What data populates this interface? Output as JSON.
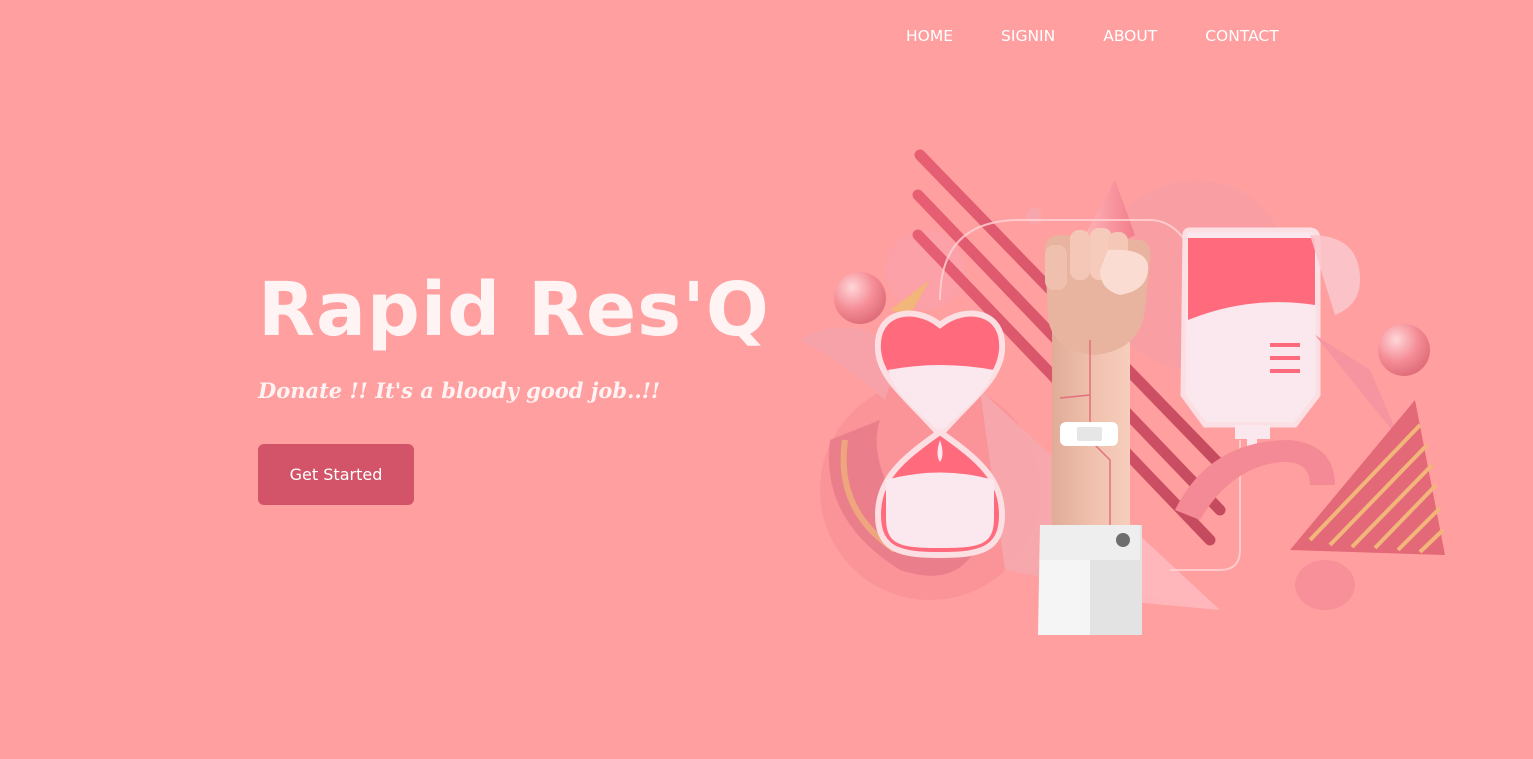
{
  "nav": {
    "items": [
      {
        "label": "HOME"
      },
      {
        "label": "SIGNIN"
      },
      {
        "label": "ABOUT"
      },
      {
        "label": "CONTACT"
      }
    ]
  },
  "hero": {
    "title": "Rapid Res'Q",
    "tagline": "Donate !! It's a bloody good job..!!",
    "cta_label": "Get Started"
  },
  "illustration": {
    "icon": "blood-donation-illustration"
  },
  "colors": {
    "background": "#ff9f9f",
    "accent": "#d35468",
    "text": "#fff3f4"
  }
}
